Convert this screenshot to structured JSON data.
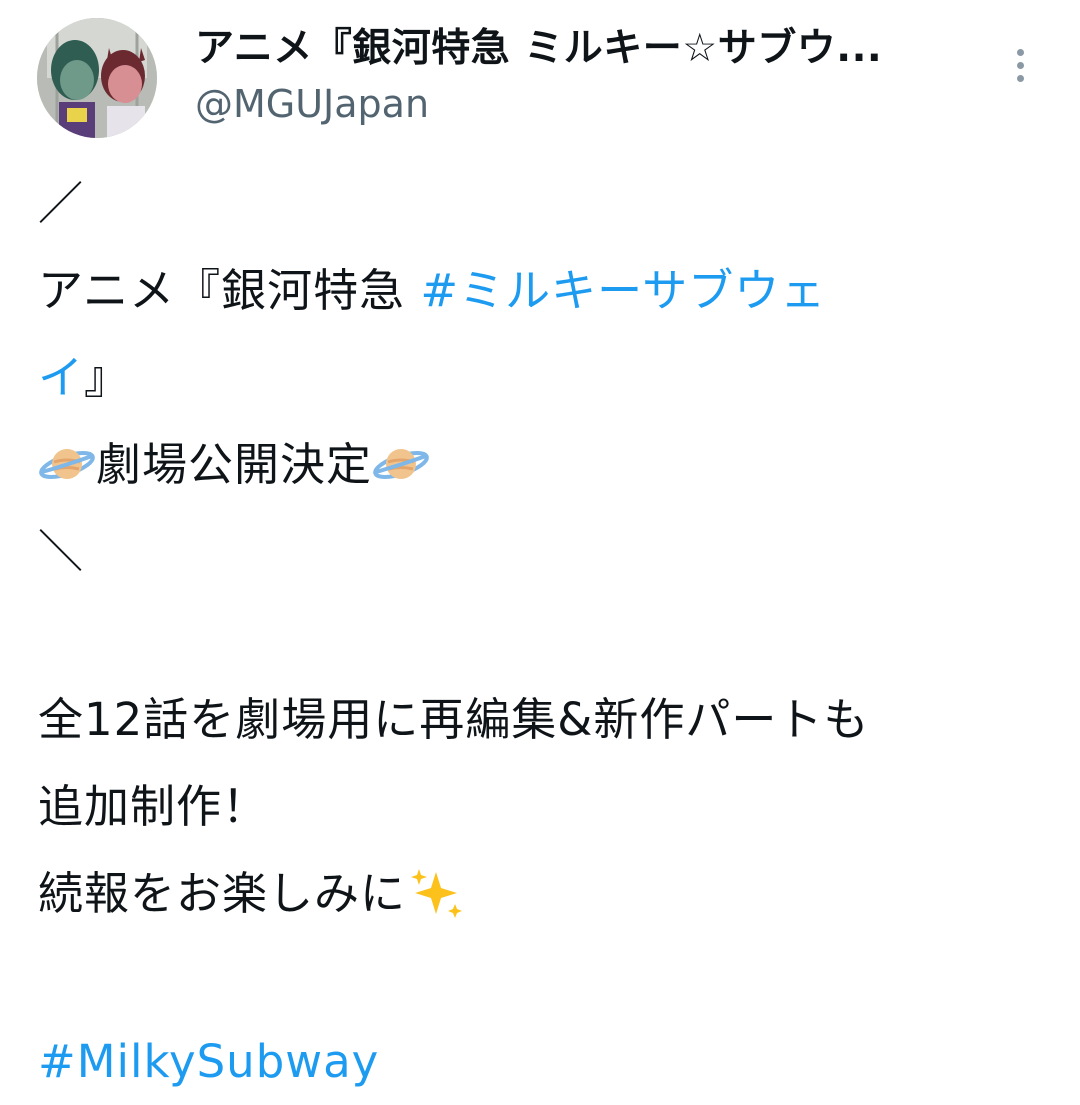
{
  "header": {
    "display_name": "アニメ『銀河特急 ミルキー☆サブウ...",
    "handle": "@MGUJapan",
    "avatar_icon": "profile-avatar-two-anime-characters",
    "more_icon": "vertical-ellipsis-icon"
  },
  "tweet": {
    "line1": "／",
    "line2_text": "アニメ『銀河特急 ",
    "line2_hashtag": "#ミルキーサブウェ",
    "line3_hashtag": "イ",
    "line3_text": "』",
    "line4_text": "劇場公開決定",
    "line5": "＼",
    "line6": "全12話を劇場用に再編集&新作パートも",
    "line7": "追加制作！",
    "line8_text": "続報をお楽しみに",
    "line9_hashtag": "#MilkySubway"
  },
  "icons": {
    "planet": "ringed-planet-emoji",
    "sparkles": "sparkles-emoji"
  },
  "colors": {
    "text": "#0f1419",
    "secondary_text": "#536471",
    "hashtag": "#1d9bf0",
    "background": "#ffffff"
  }
}
